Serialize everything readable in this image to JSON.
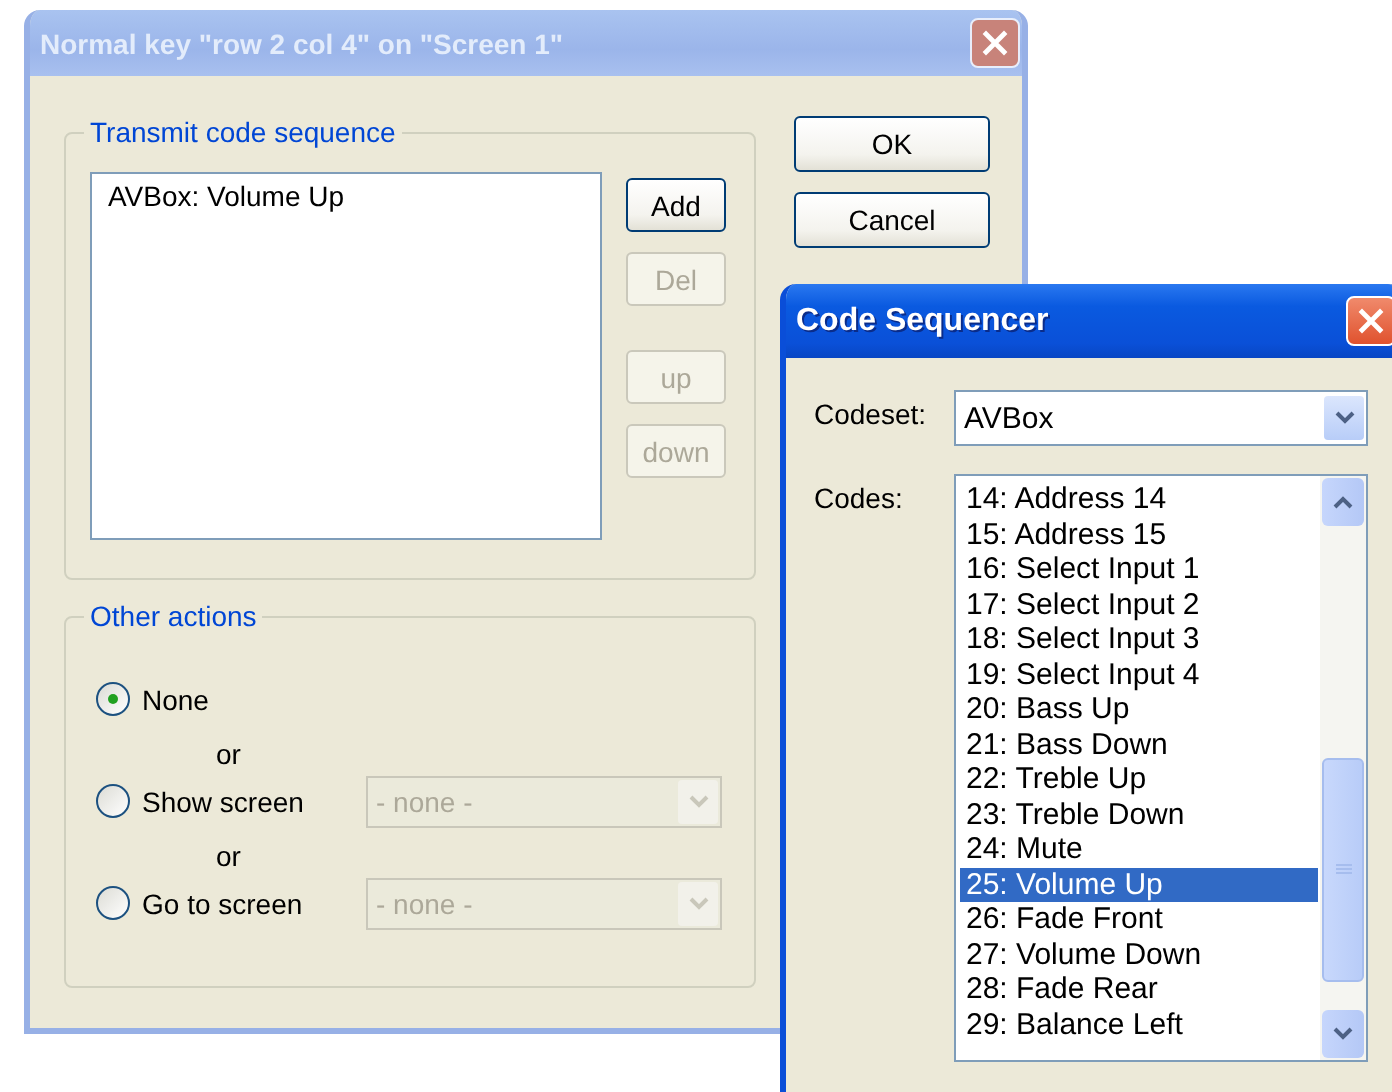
{
  "edit_dialog": {
    "title": "Normal key \"row 2 col 4\" on \"Screen 1\"",
    "active": false,
    "sequence_group": {
      "legend": "Transmit code sequence",
      "items": [
        {
          "text": "AVBox: Volume Up",
          "selected": false
        }
      ],
      "buttons": [
        {
          "label": "Add",
          "disabled": false
        },
        {
          "label": "Del",
          "disabled": true
        },
        {
          "label": "up",
          "disabled": true
        },
        {
          "label": "down",
          "disabled": true
        }
      ]
    },
    "dialog_buttons": [
      {
        "label": "OK"
      },
      {
        "label": "Cancel"
      }
    ],
    "actions_group": {
      "legend": "Other actions",
      "options": [
        {
          "label": "None",
          "selected": true
        },
        {
          "separator": "or",
          "label": "Show screen",
          "selected": false,
          "dropdown": {
            "value": "- none -",
            "disabled": true
          }
        },
        {
          "separator": "or",
          "label": "Go to screen",
          "selected": false,
          "dropdown": {
            "value": "- none -",
            "disabled": true
          }
        }
      ]
    }
  },
  "code_sequencer": {
    "title": "Code Sequencer",
    "active": true,
    "codeset": {
      "label": "Codeset:",
      "value": "AVBox"
    },
    "codes": {
      "label": "Codes:",
      "items": [
        {
          "text": "14: Address 14",
          "selected": false
        },
        {
          "text": "15: Address 15",
          "selected": false
        },
        {
          "text": "16: Select Input 1",
          "selected": false
        },
        {
          "text": "17: Select Input 2",
          "selected": false
        },
        {
          "text": "18: Select Input 3",
          "selected": false
        },
        {
          "text": "19: Select Input 4",
          "selected": false
        },
        {
          "text": "20: Bass Up",
          "selected": false
        },
        {
          "text": "21: Bass Down",
          "selected": false
        },
        {
          "text": "22: Treble Up",
          "selected": false
        },
        {
          "text": "23: Treble Down",
          "selected": false
        },
        {
          "text": "24: Mute",
          "selected": false
        },
        {
          "text": "25: Volume Up",
          "selected": true
        },
        {
          "text": "26: Fade Front",
          "selected": false
        },
        {
          "text": "27: Volume Down",
          "selected": false
        },
        {
          "text": "28: Fade Rear",
          "selected": false
        },
        {
          "text": "29: Balance Left",
          "selected": false
        }
      ]
    }
  }
}
